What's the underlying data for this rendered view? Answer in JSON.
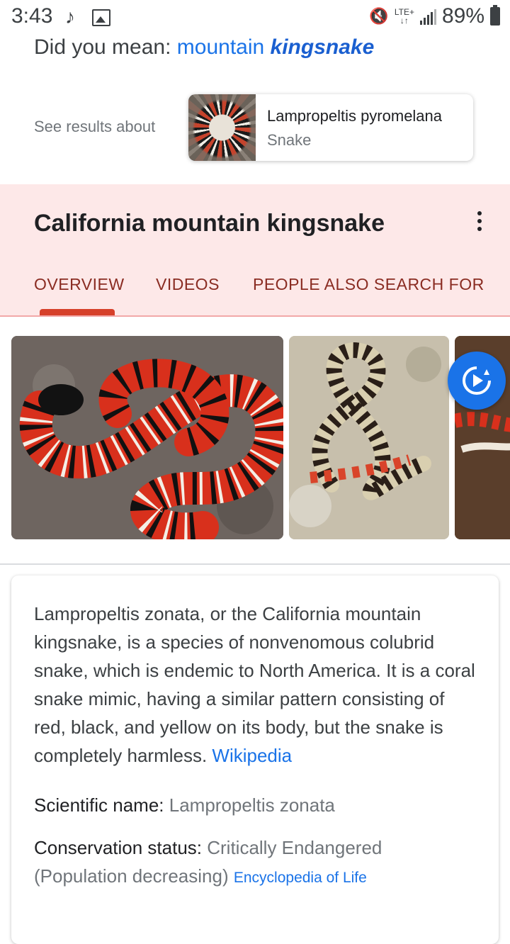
{
  "status_bar": {
    "time": "3:43",
    "note_icon": "music-note-icon",
    "network": "LTE+",
    "battery": "89%"
  },
  "did_you_mean": {
    "prefix": "Did you mean: ",
    "plain": "mountain ",
    "emphasis": "kingsnake"
  },
  "see_results": {
    "label": "See results about",
    "title": "Lampropeltis pyromelana",
    "subtitle": "Snake"
  },
  "knowledge_panel": {
    "title": "California mountain kingsnake",
    "tabs": [
      {
        "label": "OVERVIEW",
        "active": true
      },
      {
        "label": "VIDEOS",
        "active": false
      },
      {
        "label": "PEOPLE ALSO SEARCH FOR",
        "active": false
      }
    ],
    "accent": "#d6402a"
  },
  "description": {
    "text": "Lampropeltis zonata, or the California mountain kingsnake, is a species of nonvenomous colubrid snake, which is endemic to North America. It is a coral snake mimic, having a similar pattern consisting of red, black, and yellow on its body, but the snake is completely harmless. ",
    "source": "Wikipedia"
  },
  "facts": {
    "scientific_label": "Scientific name: ",
    "scientific_value": "Lampropeltis zonata",
    "conservation_label": "Conservation status: ",
    "conservation_value": "Critically Endangered (Population decreasing)",
    "conservation_source": "Encyclopedia of Life"
  }
}
